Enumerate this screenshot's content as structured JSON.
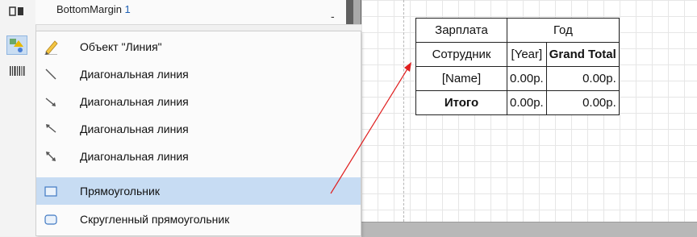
{
  "band": {
    "name": "BottomMargin",
    "number": "1",
    "collapse": "-"
  },
  "menu": {
    "items": [
      {
        "label": "Объект \"Линия\"",
        "icon": "pencil-icon"
      },
      {
        "label": "Диагональная линия",
        "icon": "diagonal-line-icon"
      },
      {
        "label": "Диагональная линия",
        "icon": "diagonal-arrow-down-right-icon"
      },
      {
        "label": "Диагональная линия",
        "icon": "diagonal-arrow-up-left-icon"
      },
      {
        "label": "Диагональная линия",
        "icon": "diagonal-double-arrow-icon"
      },
      {
        "label": "Прямоугольник",
        "icon": "rectangle-icon",
        "highlighted": true
      },
      {
        "label": "Скругленный прямоугольник",
        "icon": "rounded-rectangle-icon"
      }
    ]
  },
  "crosstab": {
    "corner": "Зарплата",
    "column_header": "Год",
    "row_header": "Сотрудник",
    "year": "[Year]",
    "grand_total": "Grand Total",
    "name": "[Name]",
    "total_label": "Итого",
    "cells": [
      "0.00р.",
      "0.00р.",
      "0.00р.",
      "0.00р."
    ]
  },
  "colors": {
    "highlight": "#c7dcf3",
    "arrow": "#e02020",
    "link": "#1e5fb3"
  }
}
